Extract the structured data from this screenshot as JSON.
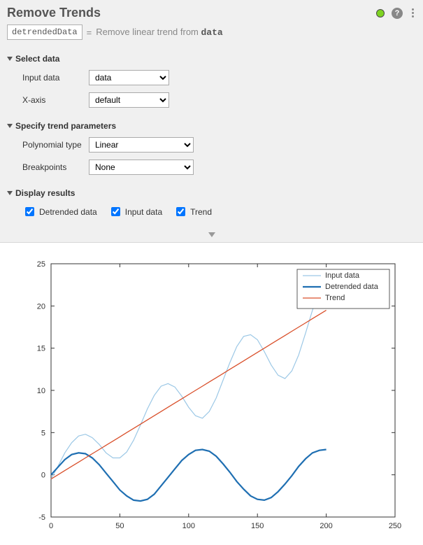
{
  "header": {
    "title": "Remove Trends",
    "output_var": "detrendedData",
    "equals": "=",
    "description_prefix": "Remove linear trend from ",
    "description_var": "data"
  },
  "sections": {
    "select_data": {
      "title": "Select data",
      "input_data": {
        "label": "Input data",
        "value": "data"
      },
      "x_axis": {
        "label": "X-axis",
        "value": "default"
      }
    },
    "trend_params": {
      "title": "Specify trend parameters",
      "poly_type": {
        "label": "Polynomial type",
        "value": "Linear"
      },
      "breakpoints": {
        "label": "Breakpoints",
        "value": "None"
      }
    },
    "display": {
      "title": "Display results",
      "detrended": {
        "label": "Detrended data",
        "checked": true
      },
      "input": {
        "label": "Input data",
        "checked": true
      },
      "trend": {
        "label": "Trend",
        "checked": true
      }
    }
  },
  "chart_data": {
    "type": "line",
    "xlabel": "",
    "ylabel": "",
    "xlim": [
      0,
      250
    ],
    "ylim": [
      -5,
      25
    ],
    "xticks": [
      0,
      50,
      100,
      150,
      200,
      250
    ],
    "yticks": [
      -5,
      0,
      5,
      10,
      15,
      20,
      25
    ],
    "legend": [
      "Input data",
      "Detrended data",
      "Trend"
    ],
    "x": [
      0,
      5,
      10,
      15,
      20,
      25,
      30,
      35,
      40,
      45,
      50,
      55,
      60,
      65,
      70,
      75,
      80,
      85,
      90,
      95,
      100,
      105,
      110,
      115,
      120,
      125,
      130,
      135,
      140,
      145,
      150,
      155,
      160,
      165,
      170,
      175,
      180,
      185,
      190,
      195,
      200
    ],
    "series": [
      {
        "name": "Input data",
        "values": [
          -0.5,
          1.0,
          2.6,
          3.8,
          4.6,
          4.8,
          4.4,
          3.6,
          2.6,
          2.0,
          2.0,
          2.7,
          4.1,
          5.9,
          7.8,
          9.4,
          10.5,
          10.8,
          10.4,
          9.3,
          8.0,
          7.0,
          6.7,
          7.5,
          9.1,
          11.2,
          13.3,
          15.2,
          16.4,
          16.6,
          16.0,
          14.6,
          13.0,
          11.8,
          11.4,
          12.3,
          14.2,
          16.8,
          19.5,
          21.8,
          23.2
        ]
      },
      {
        "name": "Detrended data",
        "values": [
          0.0,
          0.9,
          1.8,
          2.4,
          2.6,
          2.5,
          2.0,
          1.2,
          0.2,
          -0.8,
          -1.8,
          -2.5,
          -3.0,
          -3.1,
          -2.9,
          -2.3,
          -1.3,
          -0.3,
          0.7,
          1.7,
          2.4,
          2.9,
          3.0,
          2.8,
          2.2,
          1.3,
          0.3,
          -0.8,
          -1.7,
          -2.5,
          -2.9,
          -3.0,
          -2.7,
          -2.0,
          -1.1,
          -0.1,
          1.0,
          1.9,
          2.6,
          2.9,
          3.0
        ]
      },
      {
        "name": "Trend",
        "values": [
          -0.5,
          0.0,
          0.5,
          1.0,
          1.5,
          2.0,
          2.5,
          3.0,
          3.5,
          4.0,
          4.5,
          5.0,
          5.5,
          6.0,
          6.5,
          7.0,
          7.5,
          8.0,
          8.5,
          9.0,
          9.5,
          10.0,
          10.5,
          11.0,
          11.5,
          12.0,
          12.5,
          13.0,
          13.5,
          14.0,
          14.5,
          15.0,
          15.5,
          16.0,
          16.5,
          17.0,
          17.5,
          18.0,
          18.5,
          19.0,
          19.5
        ]
      }
    ]
  }
}
